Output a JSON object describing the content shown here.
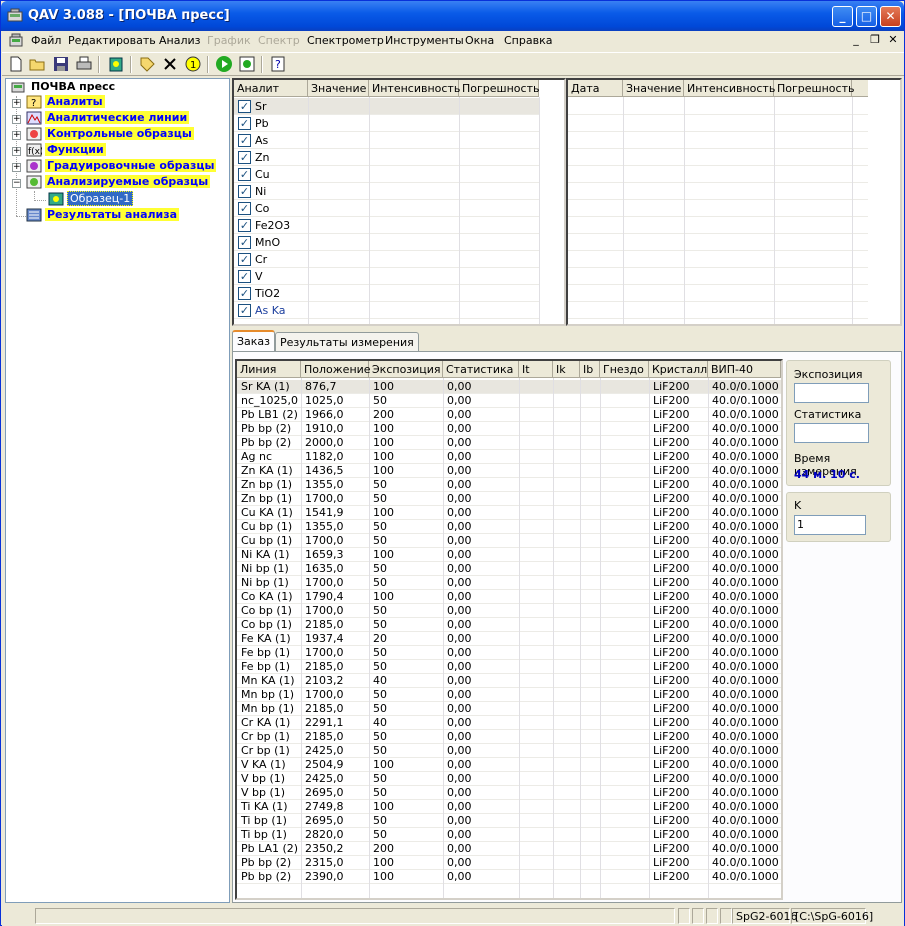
{
  "window": {
    "title": "QAV 3.088 - [ПОЧВА пресс]"
  },
  "menu": [
    "Файл",
    "Редактировать",
    "Анализ",
    "График",
    "Спектр",
    "Спектрометр",
    "Инструменты",
    "Окна",
    "Справка"
  ],
  "menu_disabled": [
    "График",
    "Спектр"
  ],
  "tree": {
    "root": "ПОЧВА пресс",
    "nodes": [
      "Аналиты",
      "Аналитические линии",
      "Контрольные образцы",
      "Функции",
      "Градуировочные образцы",
      "Анализируемые образцы"
    ],
    "child": "Образец-1",
    "results": "Результаты анализа"
  },
  "analyte_grid": {
    "headers": [
      "Аналит",
      "Значение",
      "Интенсивность",
      "Погрешность"
    ],
    "rows": [
      "Sr",
      "Pb",
      "As",
      "Zn",
      "Cu",
      "Ni",
      "Co",
      "Fe2O3",
      "MnO",
      "Cr",
      "V",
      "TiO2",
      "As Ka"
    ]
  },
  "date_grid": {
    "headers": [
      "Дата",
      "Значение",
      "Интенсивность",
      "Погрешность"
    ]
  },
  "tabs": [
    "Заказ",
    "Результаты измерения"
  ],
  "order_grid": {
    "headers": [
      "Линия",
      "Положение",
      "Экспозиция",
      "Статистика",
      "It",
      "Ik",
      "Ib",
      "Гнездо",
      "Кристалл",
      "ВИП-40"
    ],
    "rows": [
      [
        "Sr KA (1)",
        "876,7",
        "100",
        "0,00",
        "LiF200",
        "40.0/0.1000"
      ],
      [
        "nc_1025,0",
        "1025,0",
        "50",
        "0,00",
        "LiF200",
        "40.0/0.1000"
      ],
      [
        "Pb LB1 (2)",
        "1966,0",
        "200",
        "0,00",
        "LiF200",
        "40.0/0.1000"
      ],
      [
        "Pb bp (2)",
        "1910,0",
        "100",
        "0,00",
        "LiF200",
        "40.0/0.1000"
      ],
      [
        "Pb bp (2)",
        "2000,0",
        "100",
        "0,00",
        "LiF200",
        "40.0/0.1000"
      ],
      [
        "Ag nc",
        "1182,0",
        "100",
        "0,00",
        "LiF200",
        "40.0/0.1000"
      ],
      [
        "Zn KA (1)",
        "1436,5",
        "100",
        "0,00",
        "LiF200",
        "40.0/0.1000"
      ],
      [
        "Zn bp (1)",
        "1355,0",
        "50",
        "0,00",
        "LiF200",
        "40.0/0.1000"
      ],
      [
        "Zn bp (1)",
        "1700,0",
        "50",
        "0,00",
        "LiF200",
        "40.0/0.1000"
      ],
      [
        "Cu KA (1)",
        "1541,9",
        "100",
        "0,00",
        "LiF200",
        "40.0/0.1000"
      ],
      [
        "Cu bp (1)",
        "1355,0",
        "50",
        "0,00",
        "LiF200",
        "40.0/0.1000"
      ],
      [
        "Cu bp (1)",
        "1700,0",
        "50",
        "0,00",
        "LiF200",
        "40.0/0.1000"
      ],
      [
        "Ni KA (1)",
        "1659,3",
        "100",
        "0,00",
        "LiF200",
        "40.0/0.1000"
      ],
      [
        "Ni bp (1)",
        "1635,0",
        "50",
        "0,00",
        "LiF200",
        "40.0/0.1000"
      ],
      [
        "Ni bp (1)",
        "1700,0",
        "50",
        "0,00",
        "LiF200",
        "40.0/0.1000"
      ],
      [
        "Co KA (1)",
        "1790,4",
        "100",
        "0,00",
        "LiF200",
        "40.0/0.1000"
      ],
      [
        "Co bp (1)",
        "1700,0",
        "50",
        "0,00",
        "LiF200",
        "40.0/0.1000"
      ],
      [
        "Co bp (1)",
        "2185,0",
        "50",
        "0,00",
        "LiF200",
        "40.0/0.1000"
      ],
      [
        "Fe KA (1)",
        "1937,4",
        "20",
        "0,00",
        "LiF200",
        "40.0/0.1000"
      ],
      [
        "Fe bp (1)",
        "1700,0",
        "50",
        "0,00",
        "LiF200",
        "40.0/0.1000"
      ],
      [
        "Fe bp (1)",
        "2185,0",
        "50",
        "0,00",
        "LiF200",
        "40.0/0.1000"
      ],
      [
        "Mn KA (1)",
        "2103,2",
        "40",
        "0,00",
        "LiF200",
        "40.0/0.1000"
      ],
      [
        "Mn bp (1)",
        "1700,0",
        "50",
        "0,00",
        "LiF200",
        "40.0/0.1000"
      ],
      [
        "Mn bp (1)",
        "2185,0",
        "50",
        "0,00",
        "LiF200",
        "40.0/0.1000"
      ],
      [
        "Cr KA (1)",
        "2291,1",
        "40",
        "0,00",
        "LiF200",
        "40.0/0.1000"
      ],
      [
        "Cr bp (1)",
        "2185,0",
        "50",
        "0,00",
        "LiF200",
        "40.0/0.1000"
      ],
      [
        "Cr bp (1)",
        "2425,0",
        "50",
        "0,00",
        "LiF200",
        "40.0/0.1000"
      ],
      [
        "V KA (1)",
        "2504,9",
        "100",
        "0,00",
        "LiF200",
        "40.0/0.1000"
      ],
      [
        "V bp (1)",
        "2425,0",
        "50",
        "0,00",
        "LiF200",
        "40.0/0.1000"
      ],
      [
        "V bp (1)",
        "2695,0",
        "50",
        "0,00",
        "LiF200",
        "40.0/0.1000"
      ],
      [
        "Ti KA (1)",
        "2749,8",
        "100",
        "0,00",
        "LiF200",
        "40.0/0.1000"
      ],
      [
        "Ti bp (1)",
        "2695,0",
        "50",
        "0,00",
        "LiF200",
        "40.0/0.1000"
      ],
      [
        "Ti bp (1)",
        "2820,0",
        "50",
        "0,00",
        "LiF200",
        "40.0/0.1000"
      ],
      [
        "Pb LA1 (2)",
        "2350,2",
        "200",
        "0,00",
        "LiF200",
        "40.0/0.1000"
      ],
      [
        "Pb bp (2)",
        "2315,0",
        "100",
        "0,00",
        "LiF200",
        "40.0/0.1000"
      ],
      [
        "Pb bp (2)",
        "2390,0",
        "100",
        "0,00",
        "LiF200",
        "40.0/0.1000"
      ]
    ]
  },
  "right_panel": {
    "exposure_label": "Экспозиция",
    "statistics_label": "Статистика",
    "time_label": "Время измерения",
    "time_value": "44 м. 10 с.",
    "k_label": "K",
    "k_value": "1"
  },
  "status": {
    "device": "SpG2-6016",
    "path": "[C:\\SpG-6016]"
  },
  "colors": {
    "title_bar": "#0a5be8",
    "tree_highlight": "#ffff33",
    "tree_text": "#0000ff",
    "time_value": "#0000c0"
  }
}
